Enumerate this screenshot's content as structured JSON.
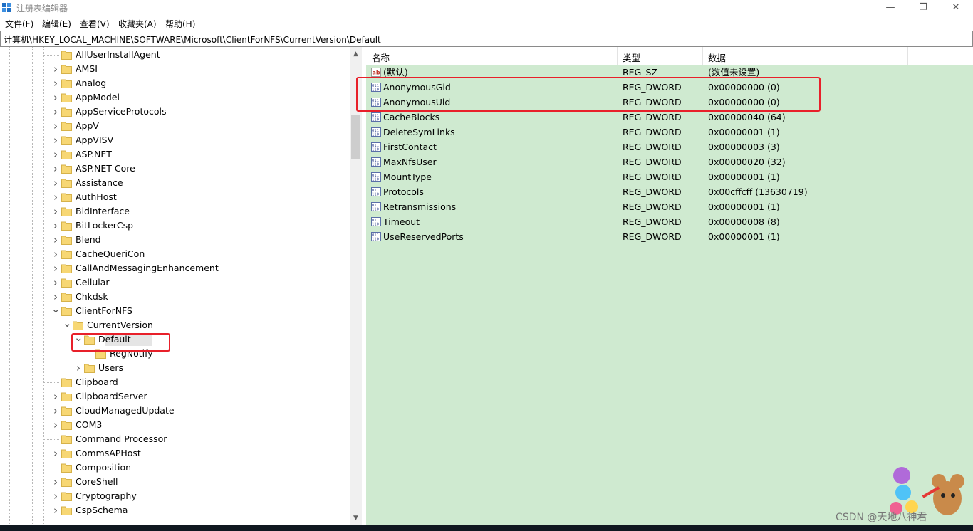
{
  "window": {
    "title": "注册表编辑器",
    "minimize_glyph": "—",
    "maximize_glyph": "❐",
    "close_glyph": "✕"
  },
  "menu": [
    "文件(F)",
    "编辑(E)",
    "查看(V)",
    "收藏夹(A)",
    "帮助(H)"
  ],
  "address": "计算机\\HKEY_LOCAL_MACHINE\\SOFTWARE\\Microsoft\\ClientForNFS\\CurrentVersion\\Default",
  "tree": {
    "items": [
      {
        "label": "AllUserInstallAgent",
        "depth": 0,
        "expander": "none"
      },
      {
        "label": "AMSI",
        "depth": 0,
        "expander": "collapsed"
      },
      {
        "label": "Analog",
        "depth": 0,
        "expander": "collapsed"
      },
      {
        "label": "AppModel",
        "depth": 0,
        "expander": "collapsed"
      },
      {
        "label": "AppServiceProtocols",
        "depth": 0,
        "expander": "collapsed"
      },
      {
        "label": "AppV",
        "depth": 0,
        "expander": "collapsed"
      },
      {
        "label": "AppVISV",
        "depth": 0,
        "expander": "collapsed"
      },
      {
        "label": "ASP.NET",
        "depth": 0,
        "expander": "collapsed"
      },
      {
        "label": "ASP.NET Core",
        "depth": 0,
        "expander": "collapsed"
      },
      {
        "label": "Assistance",
        "depth": 0,
        "expander": "collapsed"
      },
      {
        "label": "AuthHost",
        "depth": 0,
        "expander": "collapsed"
      },
      {
        "label": "BidInterface",
        "depth": 0,
        "expander": "collapsed"
      },
      {
        "label": "BitLockerCsp",
        "depth": 0,
        "expander": "collapsed"
      },
      {
        "label": "Blend",
        "depth": 0,
        "expander": "collapsed"
      },
      {
        "label": "CacheQueriCon",
        "depth": 0,
        "expander": "collapsed"
      },
      {
        "label": "CallAndMessagingEnhancement",
        "depth": 0,
        "expander": "collapsed"
      },
      {
        "label": "Cellular",
        "depth": 0,
        "expander": "collapsed"
      },
      {
        "label": "Chkdsk",
        "depth": 0,
        "expander": "collapsed"
      },
      {
        "label": "ClientForNFS",
        "depth": 0,
        "expander": "expanded"
      },
      {
        "label": "CurrentVersion",
        "depth": 1,
        "expander": "expanded"
      },
      {
        "label": "Default",
        "depth": 2,
        "expander": "expanded",
        "selected": true
      },
      {
        "label": "RegNotify",
        "depth": 3,
        "expander": "none"
      },
      {
        "label": "Users",
        "depth": 2,
        "expander": "collapsed"
      },
      {
        "label": "Clipboard",
        "depth": 0,
        "expander": "none"
      },
      {
        "label": "ClipboardServer",
        "depth": 0,
        "expander": "collapsed"
      },
      {
        "label": "CloudManagedUpdate",
        "depth": 0,
        "expander": "collapsed"
      },
      {
        "label": "COM3",
        "depth": 0,
        "expander": "collapsed"
      },
      {
        "label": "Command Processor",
        "depth": 0,
        "expander": "none"
      },
      {
        "label": "CommsAPHost",
        "depth": 0,
        "expander": "collapsed"
      },
      {
        "label": "Composition",
        "depth": 0,
        "expander": "none"
      },
      {
        "label": "CoreShell",
        "depth": 0,
        "expander": "collapsed"
      },
      {
        "label": "Cryptography",
        "depth": 0,
        "expander": "collapsed"
      },
      {
        "label": "CspSchema",
        "depth": 0,
        "expander": "collapsed"
      }
    ]
  },
  "values": {
    "columns": [
      "名称",
      "类型",
      "数据"
    ],
    "rows": [
      {
        "name": "(默认)",
        "type": "REG_SZ",
        "data": "(数值未设置)",
        "icon": "string-value-icon"
      },
      {
        "name": "AnonymousGid",
        "type": "REG_DWORD",
        "data": "0x00000000 (0)",
        "icon": "binary-value-icon"
      },
      {
        "name": "AnonymousUid",
        "type": "REG_DWORD",
        "data": "0x00000000 (0)",
        "icon": "binary-value-icon"
      },
      {
        "name": "CacheBlocks",
        "type": "REG_DWORD",
        "data": "0x00000040 (64)",
        "icon": "binary-value-icon"
      },
      {
        "name": "DeleteSymLinks",
        "type": "REG_DWORD",
        "data": "0x00000001 (1)",
        "icon": "binary-value-icon"
      },
      {
        "name": "FirstContact",
        "type": "REG_DWORD",
        "data": "0x00000003 (3)",
        "icon": "binary-value-icon"
      },
      {
        "name": "MaxNfsUser",
        "type": "REG_DWORD",
        "data": "0x00000020 (32)",
        "icon": "binary-value-icon"
      },
      {
        "name": "MountType",
        "type": "REG_DWORD",
        "data": "0x00000001 (1)",
        "icon": "binary-value-icon"
      },
      {
        "name": "Protocols",
        "type": "REG_DWORD",
        "data": "0x00cffcff (13630719)",
        "icon": "binary-value-icon"
      },
      {
        "name": "Retransmissions",
        "type": "REG_DWORD",
        "data": "0x00000001 (1)",
        "icon": "binary-value-icon"
      },
      {
        "name": "Timeout",
        "type": "REG_DWORD",
        "data": "0x00000008 (8)",
        "icon": "binary-value-icon"
      },
      {
        "name": "UseReservedPorts",
        "type": "REG_DWORD",
        "data": "0x00000001 (1)",
        "icon": "binary-value-icon"
      }
    ]
  },
  "watermark": "CSDN @天地八神君",
  "colors": {
    "values_bg": "#cfead0",
    "highlight": "#e8202a",
    "folder": "#f7d774"
  }
}
